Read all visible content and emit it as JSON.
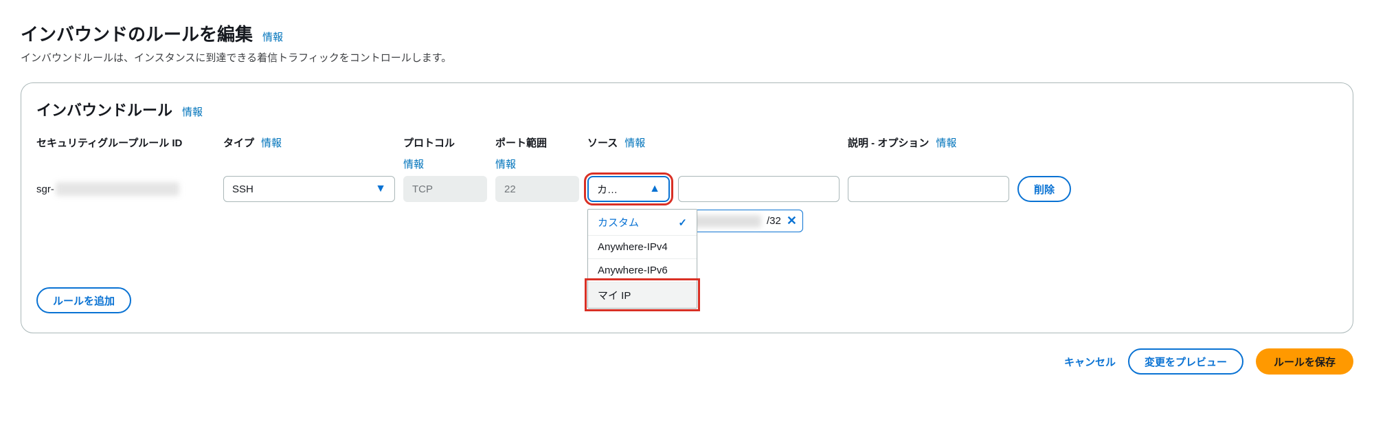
{
  "page": {
    "title": "インバウンドのルールを編集",
    "info": "情報",
    "subtitle": "インバウンドルールは、インスタンスに到達できる着信トラフィックをコントロールします。"
  },
  "panel": {
    "title": "インバウンドルール",
    "info": "情報",
    "columns": {
      "sg_rule_id": "セキュリティグループルール ID",
      "type": "タイプ",
      "protocol": "プロトコル",
      "port_range": "ポート範囲",
      "source": "ソース",
      "description": "説明 - オプション"
    },
    "row": {
      "id_prefix": "sgr-",
      "type_value": "SSH",
      "protocol_value": "TCP",
      "port_value": "22",
      "source_display": "カ…",
      "source_options": {
        "custom": "カスタム",
        "anywhere_v4": "Anywhere-IPv4",
        "anywhere_v6": "Anywhere-IPv6",
        "my_ip": "マイ IP"
      },
      "cidr_suffix": "/32",
      "delete": "削除"
    },
    "add_rule": "ルールを追加"
  },
  "footer": {
    "cancel": "キャンセル",
    "preview": "変更をプレビュー",
    "save": "ルールを保存"
  }
}
